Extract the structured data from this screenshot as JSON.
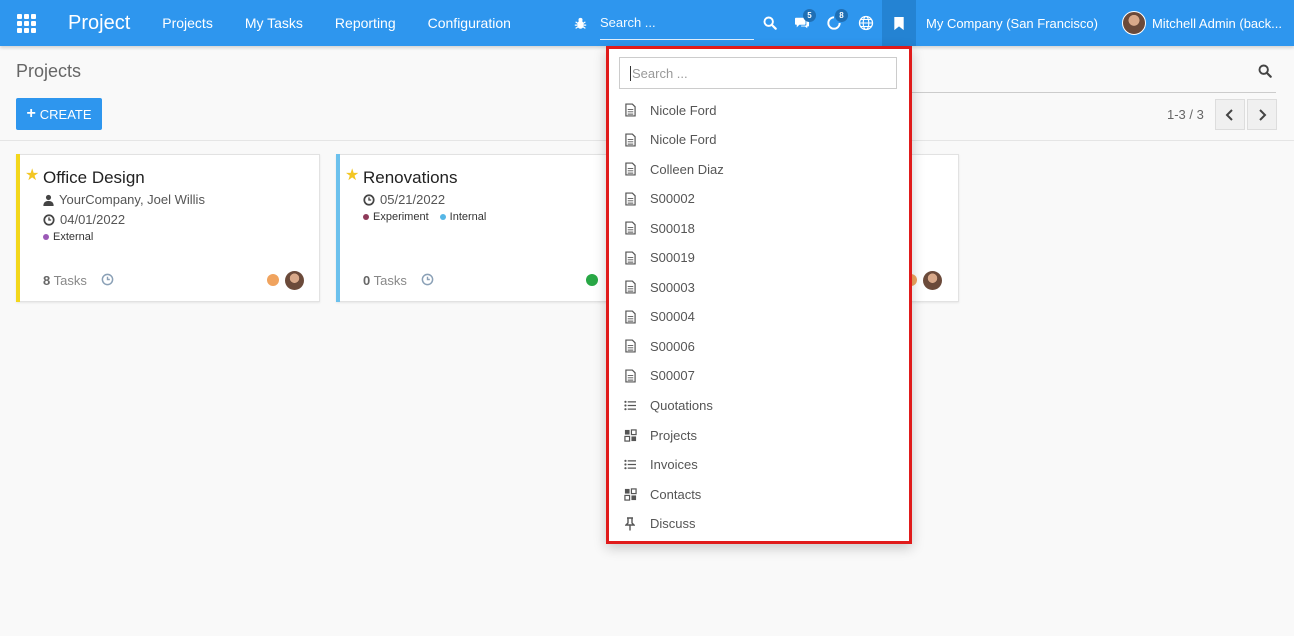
{
  "navbar": {
    "brand": "Project",
    "menu": [
      "Projects",
      "My Tasks",
      "Reporting",
      "Configuration"
    ],
    "search_placeholder": "Search ...",
    "messages_count": "5",
    "activities_count": "8",
    "company": "My Company (San Francisco)",
    "user": "Mitchell Admin (back..."
  },
  "control_panel": {
    "title": "Projects",
    "create_label": "CREATE",
    "pager": "1-3 / 3"
  },
  "cards": [
    {
      "title": "Office Design",
      "partner": "YourCompany, Joel Willis",
      "date": "04/01/2022",
      "tags": [
        {
          "label": "External",
          "color": "#9b59b6"
        }
      ],
      "tasks_count": "8",
      "tasks_label": "Tasks",
      "status_color": "#f0a35e",
      "color_bar": "#f3d71c"
    },
    {
      "title": "Renovations",
      "date": "05/21/2022",
      "tags": [
        {
          "label": "Experiment",
          "color": "#8e3a59"
        },
        {
          "label": "Internal",
          "color": "#55b6e6"
        }
      ],
      "tasks_count": "0",
      "tasks_label": "Tasks",
      "status_color": "#28a745",
      "color_bar": "#6cc1ed"
    },
    {
      "status_color": "#f0a35e"
    }
  ],
  "dropdown": {
    "search_placeholder": "Search ...",
    "items": [
      {
        "label": "Nicole Ford",
        "icon": "document-icon"
      },
      {
        "label": "Nicole Ford",
        "icon": "document-icon"
      },
      {
        "label": "Colleen Diaz",
        "icon": "document-icon"
      },
      {
        "label": "S00002",
        "icon": "document-icon"
      },
      {
        "label": "S00018",
        "icon": "document-icon"
      },
      {
        "label": "S00019",
        "icon": "document-icon"
      },
      {
        "label": "S00003",
        "icon": "document-icon"
      },
      {
        "label": "S00004",
        "icon": "document-icon"
      },
      {
        "label": "S00006",
        "icon": "document-icon"
      },
      {
        "label": "S00007",
        "icon": "document-icon"
      },
      {
        "label": "Quotations",
        "icon": "list-icon"
      },
      {
        "label": "Projects",
        "icon": "kanban-icon"
      },
      {
        "label": "Invoices",
        "icon": "list-icon"
      },
      {
        "label": "Contacts",
        "icon": "kanban-icon"
      },
      {
        "label": "Discuss",
        "icon": "pin-icon"
      }
    ]
  },
  "colors": {
    "navbar": "#2e96ee",
    "highlight_border": "#e01b1b",
    "star": "#f3c623"
  }
}
